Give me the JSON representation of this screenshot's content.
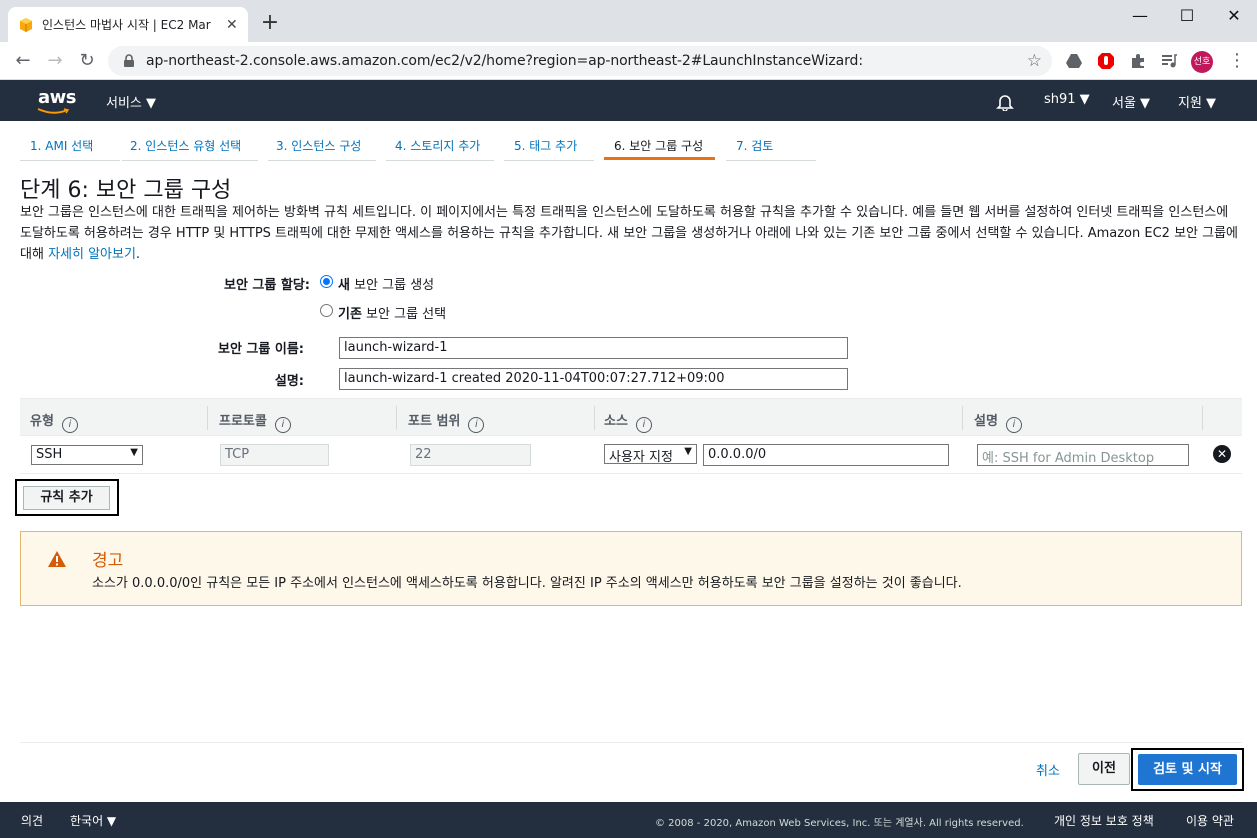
{
  "browser": {
    "tab_title": "인스턴스 마법사 시작 | EC2 Mar",
    "url": "ap-northeast-2.console.aws.amazon.com/ec2/v2/home?region=ap-northeast-2#LaunchInstanceWizard:",
    "profile_initials": "선호"
  },
  "awsnav": {
    "logo": "aws",
    "services": "서비스 ▼",
    "user": "sh91 ▼",
    "region": "서울 ▼",
    "support": "지원 ▼"
  },
  "wizard": {
    "steps": [
      "1. AMI 선택",
      "2. 인스턴스 유형 선택",
      "3. 인스턴스 구성",
      "4. 스토리지 추가",
      "5. 태그 추가",
      "6. 보안 그룹 구성",
      "7. 검토"
    ],
    "active_step": 6
  },
  "page": {
    "title": "단계 6: 보안 그룹 구성",
    "description": "보안 그룹은 인스턴스에 대한 트래픽을 제어하는 방화벽 규칙 세트입니다. 이 페이지에서는 특정 트래픽을 인스턴스에 도달하도록 허용할 규칙을 추가할 수 있습니다. 예를 들면 웹 서버를 설정하여 인터넷 트래픽을 인스턴스에 도달하도록 허용하려는 경우 HTTP 및 HTTPS 트래픽에 대한 무제한 액세스를 허용하는 규칙을 추가합니다. 새 보안 그룹을 생성하거나 아래에 나와 있는 기존 보안 그룹 중에서 선택할 수 있습니다. Amazon EC2 보안 그룹에 대해",
    "learn_more": "자세히 알아보기",
    "desc_end": "."
  },
  "form": {
    "assign_label": "보안 그룹 할당:",
    "option_new_bold": "새",
    "option_new_rest": " 보안 그룹 생성",
    "option_existing_bold": "기존",
    "option_existing_rest": " 보안 그룹 선택",
    "name_label": "보안 그룹 이름:",
    "name_value": "launch-wizard-1",
    "desc_label": "설명:",
    "desc_value": "launch-wizard-1 created 2020-11-04T00:07:27.712+09:00"
  },
  "rules": {
    "headers": [
      "유형",
      "프로토콜",
      "포트 범위",
      "소스",
      "설명"
    ],
    "row": {
      "type": "SSH",
      "protocol": "TCP",
      "port": "22",
      "source_type": "사용자 지정",
      "source_value": "0.0.0.0/0",
      "description_placeholder": "예: SSH for Admin Desktop"
    },
    "add_rule": "규칙 추가"
  },
  "warning": {
    "title": "경고",
    "message": "소스가 0.0.0.0/0인 규칙은 모든 IP 주소에서 인스턴스에 액세스하도록 허용합니다. 알려진 IP 주소의 액세스만 허용하도록 보안 그룹을 설정하는 것이 좋습니다.",
    "color": "#d45b07"
  },
  "actions": {
    "cancel": "취소",
    "previous": "이전",
    "review_launch": "검토 및 시작"
  },
  "footer": {
    "feedback": "의견",
    "language": "한국어 ▼",
    "copyright": "© 2008 - 2020, Amazon Web Services, Inc. 또는 계열사. All rights reserved.",
    "privacy": "개인 정보 보호 정책",
    "terms": "이용 약관"
  }
}
